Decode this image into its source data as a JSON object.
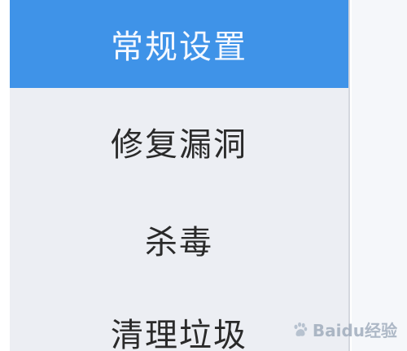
{
  "sidebar": {
    "items": [
      {
        "label": "常规设置",
        "active": true
      },
      {
        "label": "修复漏洞",
        "active": false
      },
      {
        "label": "杀毒",
        "active": false
      },
      {
        "label": "清理垃圾",
        "active": false
      }
    ]
  },
  "watermark": {
    "text": "Baidu经验"
  },
  "colors": {
    "active_bg": "#3f93e8",
    "sidebar_bg": "#eceef3",
    "content_bg": "#f5f7fa"
  }
}
